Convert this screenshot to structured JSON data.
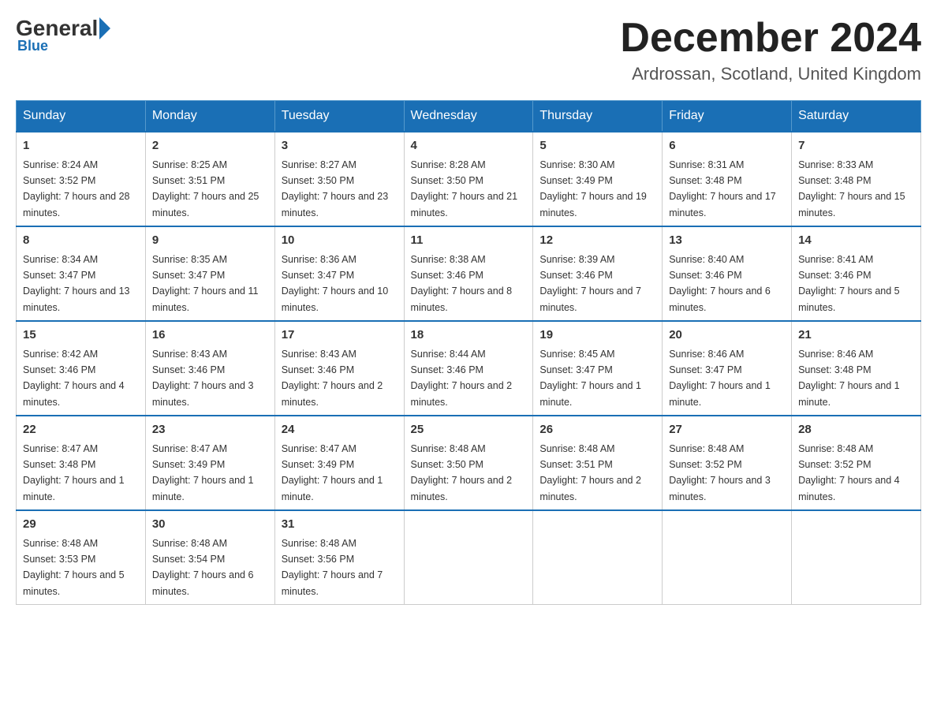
{
  "header": {
    "logo": {
      "general": "General",
      "blue": "Blue"
    },
    "title": "December 2024",
    "location": "Ardrossan, Scotland, United Kingdom"
  },
  "days_of_week": [
    "Sunday",
    "Monday",
    "Tuesday",
    "Wednesday",
    "Thursday",
    "Friday",
    "Saturday"
  ],
  "weeks": [
    [
      {
        "day": "1",
        "sunrise": "8:24 AM",
        "sunset": "3:52 PM",
        "daylight": "7 hours and 28 minutes."
      },
      {
        "day": "2",
        "sunrise": "8:25 AM",
        "sunset": "3:51 PM",
        "daylight": "7 hours and 25 minutes."
      },
      {
        "day": "3",
        "sunrise": "8:27 AM",
        "sunset": "3:50 PM",
        "daylight": "7 hours and 23 minutes."
      },
      {
        "day": "4",
        "sunrise": "8:28 AM",
        "sunset": "3:50 PM",
        "daylight": "7 hours and 21 minutes."
      },
      {
        "day": "5",
        "sunrise": "8:30 AM",
        "sunset": "3:49 PM",
        "daylight": "7 hours and 19 minutes."
      },
      {
        "day": "6",
        "sunrise": "8:31 AM",
        "sunset": "3:48 PM",
        "daylight": "7 hours and 17 minutes."
      },
      {
        "day": "7",
        "sunrise": "8:33 AM",
        "sunset": "3:48 PM",
        "daylight": "7 hours and 15 minutes."
      }
    ],
    [
      {
        "day": "8",
        "sunrise": "8:34 AM",
        "sunset": "3:47 PM",
        "daylight": "7 hours and 13 minutes."
      },
      {
        "day": "9",
        "sunrise": "8:35 AM",
        "sunset": "3:47 PM",
        "daylight": "7 hours and 11 minutes."
      },
      {
        "day": "10",
        "sunrise": "8:36 AM",
        "sunset": "3:47 PM",
        "daylight": "7 hours and 10 minutes."
      },
      {
        "day": "11",
        "sunrise": "8:38 AM",
        "sunset": "3:46 PM",
        "daylight": "7 hours and 8 minutes."
      },
      {
        "day": "12",
        "sunrise": "8:39 AM",
        "sunset": "3:46 PM",
        "daylight": "7 hours and 7 minutes."
      },
      {
        "day": "13",
        "sunrise": "8:40 AM",
        "sunset": "3:46 PM",
        "daylight": "7 hours and 6 minutes."
      },
      {
        "day": "14",
        "sunrise": "8:41 AM",
        "sunset": "3:46 PM",
        "daylight": "7 hours and 5 minutes."
      }
    ],
    [
      {
        "day": "15",
        "sunrise": "8:42 AM",
        "sunset": "3:46 PM",
        "daylight": "7 hours and 4 minutes."
      },
      {
        "day": "16",
        "sunrise": "8:43 AM",
        "sunset": "3:46 PM",
        "daylight": "7 hours and 3 minutes."
      },
      {
        "day": "17",
        "sunrise": "8:43 AM",
        "sunset": "3:46 PM",
        "daylight": "7 hours and 2 minutes."
      },
      {
        "day": "18",
        "sunrise": "8:44 AM",
        "sunset": "3:46 PM",
        "daylight": "7 hours and 2 minutes."
      },
      {
        "day": "19",
        "sunrise": "8:45 AM",
        "sunset": "3:47 PM",
        "daylight": "7 hours and 1 minute."
      },
      {
        "day": "20",
        "sunrise": "8:46 AM",
        "sunset": "3:47 PM",
        "daylight": "7 hours and 1 minute."
      },
      {
        "day": "21",
        "sunrise": "8:46 AM",
        "sunset": "3:48 PM",
        "daylight": "7 hours and 1 minute."
      }
    ],
    [
      {
        "day": "22",
        "sunrise": "8:47 AM",
        "sunset": "3:48 PM",
        "daylight": "7 hours and 1 minute."
      },
      {
        "day": "23",
        "sunrise": "8:47 AM",
        "sunset": "3:49 PM",
        "daylight": "7 hours and 1 minute."
      },
      {
        "day": "24",
        "sunrise": "8:47 AM",
        "sunset": "3:49 PM",
        "daylight": "7 hours and 1 minute."
      },
      {
        "day": "25",
        "sunrise": "8:48 AM",
        "sunset": "3:50 PM",
        "daylight": "7 hours and 2 minutes."
      },
      {
        "day": "26",
        "sunrise": "8:48 AM",
        "sunset": "3:51 PM",
        "daylight": "7 hours and 2 minutes."
      },
      {
        "day": "27",
        "sunrise": "8:48 AM",
        "sunset": "3:52 PM",
        "daylight": "7 hours and 3 minutes."
      },
      {
        "day": "28",
        "sunrise": "8:48 AM",
        "sunset": "3:52 PM",
        "daylight": "7 hours and 4 minutes."
      }
    ],
    [
      {
        "day": "29",
        "sunrise": "8:48 AM",
        "sunset": "3:53 PM",
        "daylight": "7 hours and 5 minutes."
      },
      {
        "day": "30",
        "sunrise": "8:48 AM",
        "sunset": "3:54 PM",
        "daylight": "7 hours and 6 minutes."
      },
      {
        "day": "31",
        "sunrise": "8:48 AM",
        "sunset": "3:56 PM",
        "daylight": "7 hours and 7 minutes."
      },
      null,
      null,
      null,
      null
    ]
  ]
}
